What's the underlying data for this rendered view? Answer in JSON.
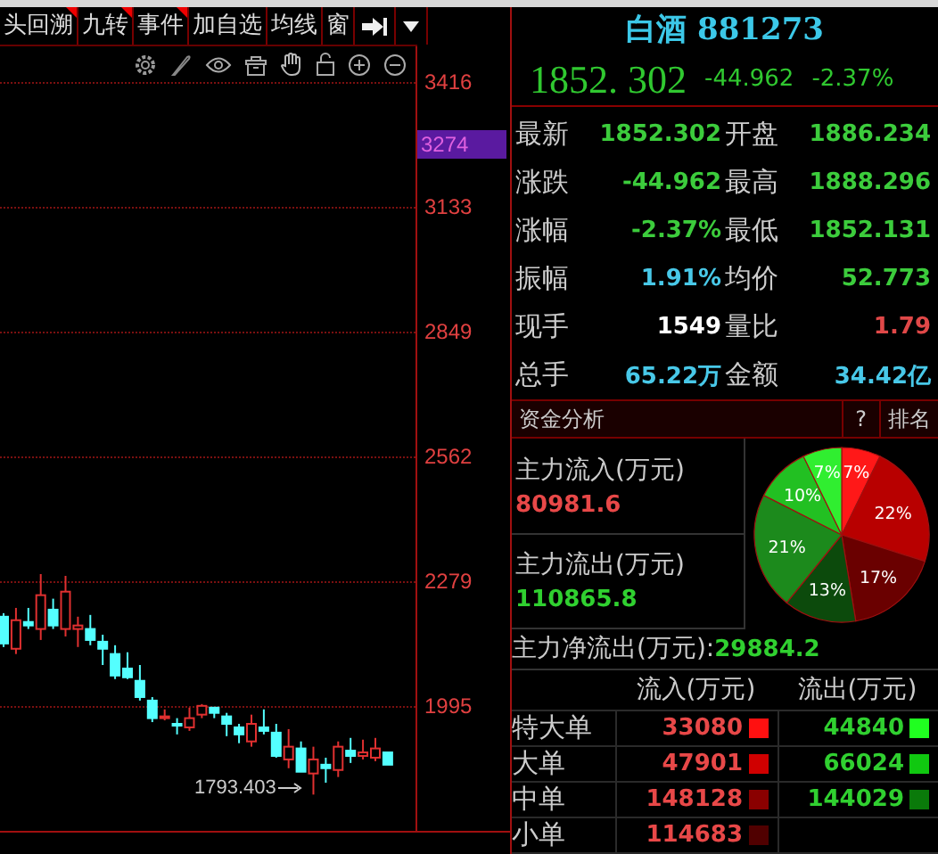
{
  "toolbar": {
    "tabs": [
      {
        "label": "头回溯",
        "flag": true
      },
      {
        "label": "九转",
        "flag": true
      },
      {
        "label": "事件",
        "flag": true
      },
      {
        "label": "加自选",
        "flag": false
      },
      {
        "label": "均线",
        "flag": false
      },
      {
        "label": "窗",
        "flag": false
      }
    ]
  },
  "chart": {
    "current_price": "3274",
    "low_marker": "1793.403",
    "chart_data": {
      "type": "candlestick",
      "ylim": [
        1711,
        3497
      ],
      "grid": true,
      "yticks": [
        3416,
        3133,
        2849,
        2562,
        2279,
        1995
      ],
      "categories": [
        null,
        null,
        null,
        null,
        null,
        null,
        null,
        null,
        null,
        null,
        null,
        null,
        null,
        null,
        null,
        null,
        null,
        null,
        null,
        null,
        null,
        null,
        null,
        null,
        null,
        null,
        null,
        null,
        null,
        null,
        null,
        null
      ],
      "ohlc": [
        [
          2198,
          2206,
          2129,
          2137
        ],
        [
          2125,
          2218,
          2113,
          2190
        ],
        [
          2186,
          2218,
          2170,
          2178
        ],
        [
          2170,
          2295,
          2145,
          2247
        ],
        [
          2214,
          2239,
          2170,
          2178
        ],
        [
          2170,
          2291,
          2153,
          2255
        ],
        [
          2170,
          2198,
          2129,
          2178
        ],
        [
          2170,
          2202,
          2133,
          2145
        ],
        [
          2141,
          2157,
          2088,
          2125
        ],
        [
          2113,
          2133,
          2056,
          2064
        ],
        [
          2080,
          2117,
          2056,
          2060
        ],
        [
          2052,
          2088,
          2007,
          2015
        ],
        [
          2007,
          2015,
          1958,
          1967
        ],
        [
          1967,
          1987,
          1962,
          1971
        ],
        [
          1954,
          1967,
          1930,
          1950
        ],
        [
          1946,
          1991,
          1938,
          1967
        ],
        [
          1975,
          1999,
          1967,
          1995
        ],
        [
          1991,
          1991,
          1967,
          1979
        ],
        [
          1971,
          1979,
          1926,
          1954
        ],
        [
          1946,
          1954,
          1910,
          1930
        ],
        [
          1914,
          1975,
          1902,
          1954
        ],
        [
          1946,
          1987,
          1930,
          1938
        ],
        [
          1934,
          1954,
          1877,
          1881
        ],
        [
          1873,
          1942,
          1853,
          1902
        ],
        [
          1898,
          1914,
          1845,
          1845
        ],
        [
          1841,
          1902,
          1793,
          1873
        ],
        [
          1861,
          1877,
          1820,
          1853
        ],
        [
          1849,
          1914,
          1833,
          1902
        ],
        [
          1893,
          1922,
          1865,
          1881
        ],
        [
          1881,
          1918,
          1873,
          1889
        ],
        [
          1877,
          1922,
          1869,
          1898
        ],
        [
          1889,
          1889,
          1861,
          1861
        ]
      ]
    }
  },
  "quote": {
    "name": "白酒",
    "code": "881273",
    "price": "1852. 302",
    "change": "-44.962",
    "change_pct": "-2.37%"
  },
  "stats": [
    {
      "label": "最新",
      "value": "1852.302",
      "color": "#3ccc3c"
    },
    {
      "label": "开盘",
      "value": "1886.234",
      "color": "#3ccc3c"
    },
    {
      "label": "涨跌",
      "value": "-44.962",
      "color": "#3ccc3c"
    },
    {
      "label": "最高",
      "value": "1888.296",
      "color": "#3ccc3c"
    },
    {
      "label": "涨幅",
      "value": "-2.37%",
      "color": "#3ccc3c"
    },
    {
      "label": "最低",
      "value": "1852.131",
      "color": "#3ccc3c"
    },
    {
      "label": "振幅",
      "value": "1.91%",
      "color": "#48c8e8"
    },
    {
      "label": "均价",
      "value": "52.773",
      "color": "#3ccc3c"
    },
    {
      "label": "现手",
      "value": "1549",
      "color": "#ffffff"
    },
    {
      "label": "量比",
      "value": "1.79",
      "color": "#e04848"
    },
    {
      "label": "总手",
      "value": "65.22万",
      "color": "#48c8e8"
    },
    {
      "label": "金额",
      "value": "34.42亿",
      "color": "#48c8e8"
    }
  ],
  "fund_analysis": {
    "title": "资金分析",
    "help": "?",
    "rank": "排名",
    "inflow": {
      "label": "主力流入(万元)",
      "value": "80981.6"
    },
    "outflow": {
      "label": "主力流出(万元)",
      "value": "110865.8"
    },
    "chart_data": {
      "type": "pie",
      "values": [
        7,
        22,
        17,
        13,
        21,
        10,
        7
      ],
      "data_labels": true,
      "value_labels": [
        "7%",
        "22%",
        "17%",
        "13%",
        "21%",
        "10%",
        "7%"
      ]
    },
    "net": {
      "label": "主力净流出(万元):",
      "value": "29884.2"
    },
    "columns": [
      "流入(万元)",
      "流出(万元)"
    ],
    "rows": [
      {
        "label": "特大单",
        "inflow": {
          "value": "33080",
          "color": "#ff1010"
        },
        "outflow": {
          "value": "44840",
          "color": "#20ff20"
        }
      },
      {
        "label": "大单",
        "inflow": {
          "value": "47901",
          "color": "#d00000"
        },
        "outflow": {
          "value": "66024",
          "color": "#10c810"
        }
      },
      {
        "label": "中单",
        "inflow": {
          "value": "148128",
          "color": "#8a0000"
        },
        "outflow": {
          "value": "144029",
          "color": "#0a7a0a"
        }
      },
      {
        "label": "小单",
        "inflow": {
          "value": "114683",
          "color": "#500000"
        }
      }
    ]
  }
}
